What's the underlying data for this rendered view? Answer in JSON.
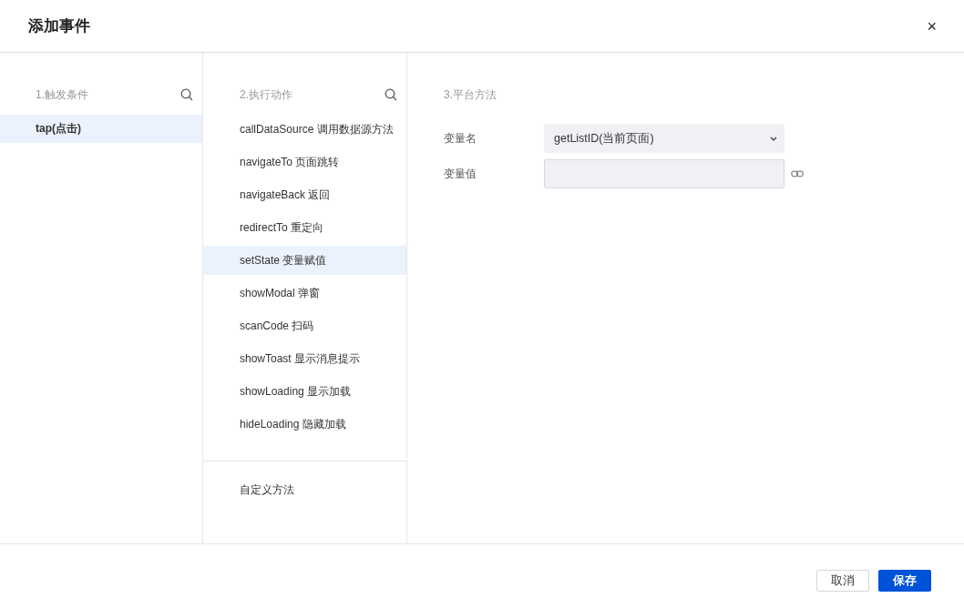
{
  "dialog": {
    "title": "添加事件",
    "close": "×"
  },
  "triggers": {
    "heading": "1.触发条件",
    "items": [
      {
        "label": "tap(点击)",
        "selected": true
      }
    ]
  },
  "actions": {
    "heading": "2.执行动作",
    "items": [
      {
        "label": "callDataSource 调用数据源方法",
        "selected": false
      },
      {
        "label": "navigateTo 页面跳转",
        "selected": false
      },
      {
        "label": "navigateBack 返回",
        "selected": false
      },
      {
        "label": "redirectTo 重定向",
        "selected": false
      },
      {
        "label": "setState 变量赋值",
        "selected": true
      },
      {
        "label": "showModal 弹窗",
        "selected": false
      },
      {
        "label": "scanCode 扫码",
        "selected": false
      },
      {
        "label": "showToast 显示消息提示",
        "selected": false
      },
      {
        "label": "showLoading 显示加载",
        "selected": false
      },
      {
        "label": "hideLoading 隐藏加载",
        "selected": false
      }
    ],
    "custom": {
      "label": "自定义方法",
      "selected": false
    }
  },
  "platform": {
    "heading": "3.平台方法",
    "fields": [
      {
        "label": "变量名",
        "kind": "select",
        "value": "getListID(当前页面)"
      },
      {
        "label": "变量值",
        "kind": "input"
      }
    ]
  },
  "buttons": [
    {
      "label": "取消",
      "kind": "secondary"
    },
    {
      "label": "保存",
      "kind": "primary"
    }
  ]
}
